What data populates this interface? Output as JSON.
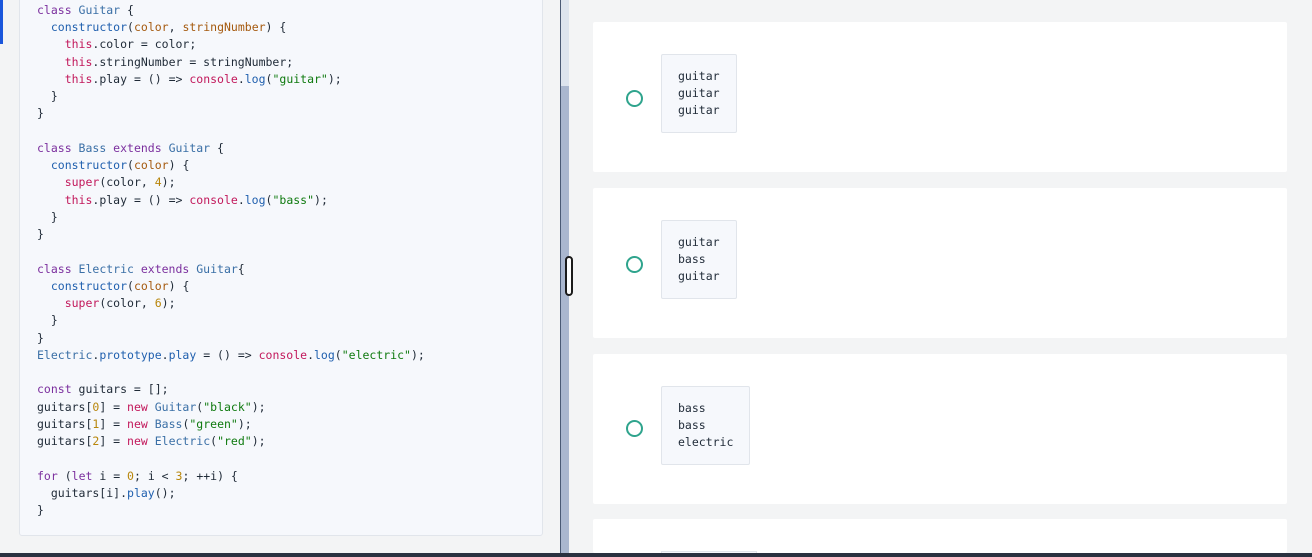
{
  "code": {
    "lines": [
      [
        {
          "t": "class ",
          "c": "kw"
        },
        {
          "t": "Guitar",
          "c": "ty"
        },
        {
          "t": " {",
          "c": ""
        }
      ],
      [
        {
          "t": "  ",
          "c": ""
        },
        {
          "t": "constructor",
          "c": "fn"
        },
        {
          "t": "(",
          "c": ""
        },
        {
          "t": "color",
          "c": "pm"
        },
        {
          "t": ", ",
          "c": ""
        },
        {
          "t": "stringNumber",
          "c": "pm"
        },
        {
          "t": ") {",
          "c": ""
        }
      ],
      [
        {
          "t": "    ",
          "c": ""
        },
        {
          "t": "this",
          "c": "th"
        },
        {
          "t": ".color = color;",
          "c": ""
        }
      ],
      [
        {
          "t": "    ",
          "c": ""
        },
        {
          "t": "this",
          "c": "th"
        },
        {
          "t": ".stringNumber = stringNumber;",
          "c": ""
        }
      ],
      [
        {
          "t": "    ",
          "c": ""
        },
        {
          "t": "this",
          "c": "th"
        },
        {
          "t": ".play = () => ",
          "c": ""
        },
        {
          "t": "console",
          "c": "th"
        },
        {
          "t": ".",
          "c": ""
        },
        {
          "t": "log",
          "c": "fn"
        },
        {
          "t": "(",
          "c": ""
        },
        {
          "t": "\"guitar\"",
          "c": "st"
        },
        {
          "t": ");",
          "c": ""
        }
      ],
      [
        {
          "t": "  }",
          "c": ""
        }
      ],
      [
        {
          "t": "}",
          "c": ""
        }
      ],
      [],
      [
        {
          "t": "class ",
          "c": "kw"
        },
        {
          "t": "Bass ",
          "c": "ty"
        },
        {
          "t": "extends ",
          "c": "kw"
        },
        {
          "t": "Guitar",
          "c": "ty"
        },
        {
          "t": " {",
          "c": ""
        }
      ],
      [
        {
          "t": "  ",
          "c": ""
        },
        {
          "t": "constructor",
          "c": "fn"
        },
        {
          "t": "(",
          "c": ""
        },
        {
          "t": "color",
          "c": "pm"
        },
        {
          "t": ") {",
          "c": ""
        }
      ],
      [
        {
          "t": "    ",
          "c": ""
        },
        {
          "t": "super",
          "c": "th"
        },
        {
          "t": "(color, ",
          "c": ""
        },
        {
          "t": "4",
          "c": "nm"
        },
        {
          "t": ");",
          "c": ""
        }
      ],
      [
        {
          "t": "    ",
          "c": ""
        },
        {
          "t": "this",
          "c": "th"
        },
        {
          "t": ".play = () => ",
          "c": ""
        },
        {
          "t": "console",
          "c": "th"
        },
        {
          "t": ".",
          "c": ""
        },
        {
          "t": "log",
          "c": "fn"
        },
        {
          "t": "(",
          "c": ""
        },
        {
          "t": "\"bass\"",
          "c": "st"
        },
        {
          "t": ");",
          "c": ""
        }
      ],
      [
        {
          "t": "  }",
          "c": ""
        }
      ],
      [
        {
          "t": "}",
          "c": ""
        }
      ],
      [],
      [
        {
          "t": "class ",
          "c": "kw"
        },
        {
          "t": "Electric ",
          "c": "ty"
        },
        {
          "t": "extends ",
          "c": "kw"
        },
        {
          "t": "Guitar",
          "c": "ty"
        },
        {
          "t": "{",
          "c": ""
        }
      ],
      [
        {
          "t": "  ",
          "c": ""
        },
        {
          "t": "constructor",
          "c": "fn"
        },
        {
          "t": "(",
          "c": ""
        },
        {
          "t": "color",
          "c": "pm"
        },
        {
          "t": ") {",
          "c": ""
        }
      ],
      [
        {
          "t": "    ",
          "c": ""
        },
        {
          "t": "super",
          "c": "th"
        },
        {
          "t": "(color, ",
          "c": ""
        },
        {
          "t": "6",
          "c": "nm"
        },
        {
          "t": ");",
          "c": ""
        }
      ],
      [
        {
          "t": "  }",
          "c": ""
        }
      ],
      [
        {
          "t": "}",
          "c": ""
        }
      ],
      [
        {
          "t": "Electric",
          "c": "ty"
        },
        {
          "t": ".",
          "c": ""
        },
        {
          "t": "prototype",
          "c": "fn"
        },
        {
          "t": ".",
          "c": ""
        },
        {
          "t": "play",
          "c": "fn"
        },
        {
          "t": " = () => ",
          "c": ""
        },
        {
          "t": "console",
          "c": "th"
        },
        {
          "t": ".",
          "c": ""
        },
        {
          "t": "log",
          "c": "fn"
        },
        {
          "t": "(",
          "c": ""
        },
        {
          "t": "\"electric\"",
          "c": "st"
        },
        {
          "t": ");",
          "c": ""
        }
      ],
      [],
      [
        {
          "t": "const ",
          "c": "kw"
        },
        {
          "t": "guitars = [];",
          "c": ""
        }
      ],
      [
        {
          "t": "guitars[",
          "c": ""
        },
        {
          "t": "0",
          "c": "nm"
        },
        {
          "t": "] = ",
          "c": ""
        },
        {
          "t": "new ",
          "c": "th"
        },
        {
          "t": "Guitar",
          "c": "ty"
        },
        {
          "t": "(",
          "c": ""
        },
        {
          "t": "\"black\"",
          "c": "st"
        },
        {
          "t": ");",
          "c": ""
        }
      ],
      [
        {
          "t": "guitars[",
          "c": ""
        },
        {
          "t": "1",
          "c": "nm"
        },
        {
          "t": "] = ",
          "c": ""
        },
        {
          "t": "new ",
          "c": "th"
        },
        {
          "t": "Bass",
          "c": "ty"
        },
        {
          "t": "(",
          "c": ""
        },
        {
          "t": "\"green\"",
          "c": "st"
        },
        {
          "t": ");",
          "c": ""
        }
      ],
      [
        {
          "t": "guitars[",
          "c": ""
        },
        {
          "t": "2",
          "c": "nm"
        },
        {
          "t": "] = ",
          "c": ""
        },
        {
          "t": "new ",
          "c": "th"
        },
        {
          "t": "Electric",
          "c": "ty"
        },
        {
          "t": "(",
          "c": ""
        },
        {
          "t": "\"red\"",
          "c": "st"
        },
        {
          "t": ");",
          "c": ""
        }
      ],
      [],
      [
        {
          "t": "for ",
          "c": "kw"
        },
        {
          "t": "(",
          "c": ""
        },
        {
          "t": "let ",
          "c": "kw"
        },
        {
          "t": "i = ",
          "c": ""
        },
        {
          "t": "0",
          "c": "nm"
        },
        {
          "t": "; i < ",
          "c": ""
        },
        {
          "t": "3",
          "c": "nm"
        },
        {
          "t": "; ++i) {",
          "c": ""
        }
      ],
      [
        {
          "t": "  guitars[i].",
          "c": ""
        },
        {
          "t": "play",
          "c": "fn"
        },
        {
          "t": "();",
          "c": ""
        }
      ],
      [
        {
          "t": "}",
          "c": ""
        }
      ]
    ]
  },
  "options": [
    {
      "lines": [
        "guitar",
        "guitar",
        "guitar"
      ]
    },
    {
      "lines": [
        "guitar",
        "bass",
        "guitar"
      ]
    },
    {
      "lines": [
        "bass",
        "bass",
        "electric"
      ]
    },
    {
      "lines": []
    }
  ],
  "colors": {
    "accent": "#1a56db",
    "radio": "#2fa48d"
  }
}
